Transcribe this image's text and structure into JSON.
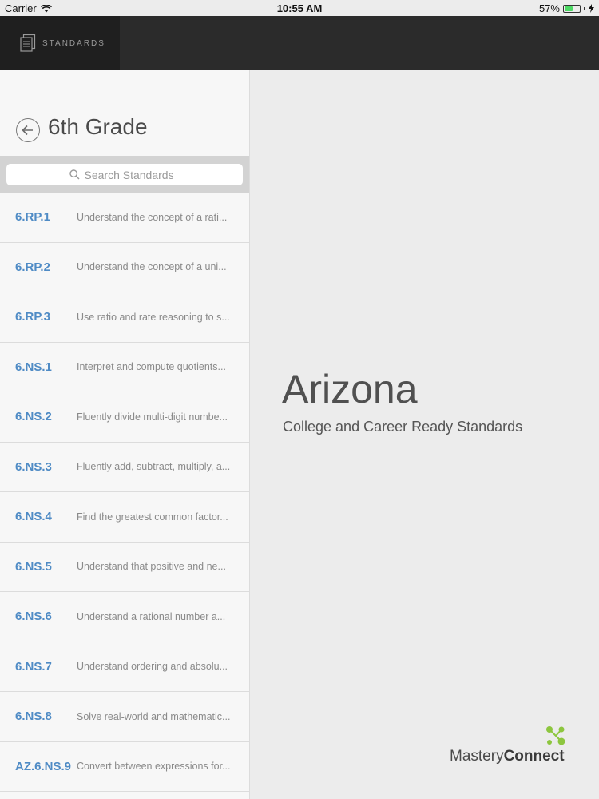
{
  "status": {
    "carrier": "Carrier",
    "time": "10:55 AM",
    "battery": "57%",
    "battery_level": 0.57
  },
  "topbar": {
    "tab_label": "STANDARDS"
  },
  "sidebar": {
    "title": "6th Grade",
    "search_placeholder": "Search Standards",
    "items": [
      {
        "code": "6.RP.1",
        "desc": "Understand the concept of a rati..."
      },
      {
        "code": "6.RP.2",
        "desc": "Understand the concept of a uni..."
      },
      {
        "code": "6.RP.3",
        "desc": "Use ratio and rate reasoning to s..."
      },
      {
        "code": "6.NS.1",
        "desc": "Interpret and compute quotients..."
      },
      {
        "code": "6.NS.2",
        "desc": "Fluently divide multi-digit numbe..."
      },
      {
        "code": "6.NS.3",
        "desc": "Fluently add, subtract, multiply, a..."
      },
      {
        "code": "6.NS.4",
        "desc": "Find the greatest common factor..."
      },
      {
        "code": "6.NS.5",
        "desc": "Understand that positive and ne..."
      },
      {
        "code": "6.NS.6",
        "desc": "Understand a rational number a..."
      },
      {
        "code": "6.NS.7",
        "desc": "Understand ordering and absolu..."
      },
      {
        "code": "6.NS.8",
        "desc": "Solve real-world and mathematic..."
      },
      {
        "code": "AZ.6.NS.9",
        "desc": "Convert between expressions for..."
      }
    ]
  },
  "main": {
    "state": "Arizona",
    "subtitle": "College and Career Ready Standards"
  },
  "brand": {
    "name_light": "Mastery",
    "name_bold": "Connect",
    "logo_color": "#8dc63f"
  }
}
